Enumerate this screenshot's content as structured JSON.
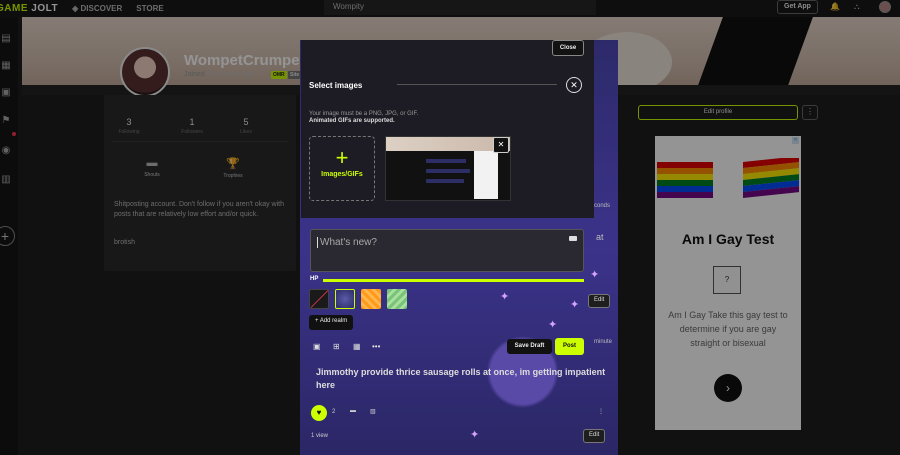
{
  "nav": {
    "logo_game": "GAME",
    "logo_jolt": "JOLT",
    "discover": "DISCOVER",
    "store": "STORE",
    "search_value": "Wompity",
    "get_app": "Get App"
  },
  "profile": {
    "name": "WompetCrumpet",
    "joined_prefix": "Joined",
    "joined_time": "11 minutes ago",
    "tag1": "OMR",
    "tag2": "Site",
    "stats": [
      {
        "value": "3",
        "label": "Following"
      },
      {
        "value": "1",
        "label": "Followers"
      },
      {
        "value": "5",
        "label": "Likes"
      }
    ],
    "shouts_label": "Shouts",
    "trophies_label": "Trophies",
    "bio": "Shitposting account. Don't follow if you aren't okay with posts that are relatively low effort and/or quick.",
    "bio2": "brotish"
  },
  "right": {
    "edit_profile": "Edit profile",
    "more": "⋮"
  },
  "ad": {
    "title": "Am I Gay Test",
    "logo_text": "?",
    "text": "Am I Gay Take this gay test to determine if you are gay straight or bisexual",
    "arrow": "›"
  },
  "modal": {
    "close": "Close",
    "title": "Select images",
    "hint1": "Your image must be a PNG, JPG, or GIF.",
    "hint2": "Animated GIFs are supported.",
    "upload_plus": "+",
    "upload_label": "Images/GIFs",
    "composer_placeholder": "What's new?",
    "hp_label": "HP",
    "add_realm": "+ Add realm",
    "save_draft": "Save Draft",
    "post": "Post"
  },
  "feed": {
    "side1": "conds",
    "side2": "at",
    "side3": "minute",
    "edit": "Edit",
    "post_text": "Jimmothy provide thrice sausage rolls at once, im getting impatient here",
    "like_count": "2",
    "views": "1 view"
  }
}
